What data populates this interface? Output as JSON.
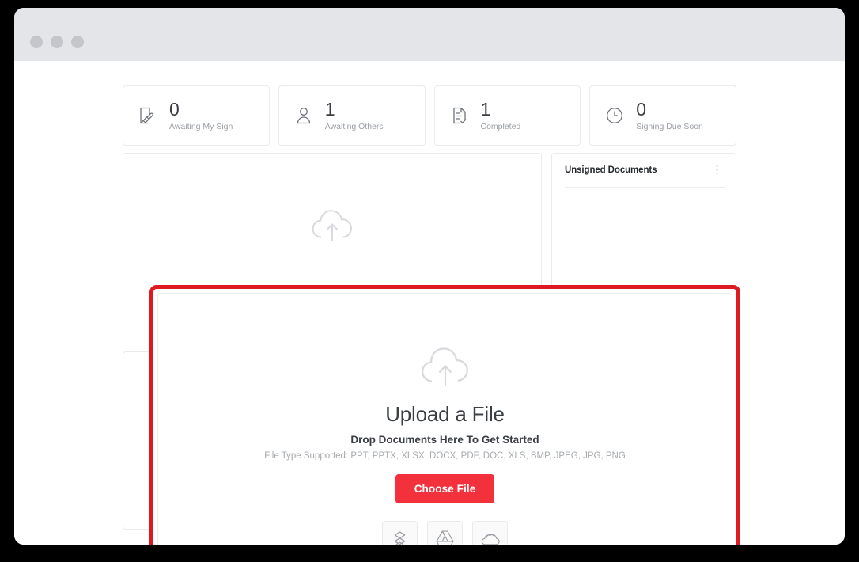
{
  "window": {
    "dots": [
      "window-dot-close",
      "window-dot-minimize",
      "window-dot-maximize"
    ]
  },
  "stats": [
    {
      "value": "0",
      "label": "Awaiting My Sign",
      "icon": "document-sign-icon"
    },
    {
      "value": "1",
      "label": "Awaiting Others",
      "icon": "person-icon"
    },
    {
      "value": "1",
      "label": "Completed",
      "icon": "document-check-icon"
    },
    {
      "value": "0",
      "label": "Signing Due Soon",
      "icon": "clock-icon"
    }
  ],
  "panels": {
    "unsigned_documents": {
      "title": "Unsigned Documents",
      "menu_glyph": "⋮"
    }
  },
  "upload_modal": {
    "title": "Upload a File",
    "subtitle": "Drop Documents Here To Get Started",
    "file_types": "File Type Supported: PPT, PPTX, XLSX, DOCX, PDF, DOC, XLS, BMP, JPEG, JPG, PNG",
    "choose_file_label": "Choose File",
    "cloud_sources": [
      {
        "name": "dropbox-icon"
      },
      {
        "name": "google-drive-icon"
      },
      {
        "name": "onedrive-icon"
      }
    ]
  },
  "colors": {
    "accent_red": "#f2313c",
    "highlight_border": "#dd1a22",
    "titlebar": "#e3e5e9",
    "card_border": "#e8eaec",
    "muted_text": "#a6aaae",
    "heading_text": "#3b3f44"
  }
}
